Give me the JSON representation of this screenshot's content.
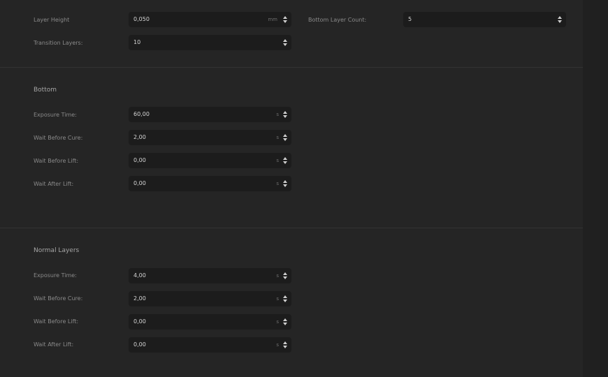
{
  "general": {
    "layer_height": {
      "label": "Layer Height",
      "value": "0,050",
      "unit": "mm"
    },
    "bottom_layer_count": {
      "label": "Bottom Layer Count:",
      "value": "5"
    },
    "transition_layers": {
      "label": "Transition Layers:",
      "value": "10"
    }
  },
  "bottom": {
    "title": "Bottom",
    "exposure_time": {
      "label": "Exposure Time:",
      "value": "60,00",
      "unit": "s"
    },
    "wait_before_cure": {
      "label": "Wait Before Cure:",
      "value": "2,00",
      "unit": "s"
    },
    "wait_before_lift": {
      "label": "Wait Before Lift:",
      "value": "0,00",
      "unit": "s"
    },
    "wait_after_lift": {
      "label": "Wait After Lift:",
      "value": "0,00",
      "unit": "s"
    }
  },
  "normal": {
    "title": "Normal Layers",
    "exposure_time": {
      "label": "Exposure Time:",
      "value": "4,00",
      "unit": "s"
    },
    "wait_before_cure": {
      "label": "Wait Before Cure:",
      "value": "2,00",
      "unit": "s"
    },
    "wait_before_lift": {
      "label": "Wait Before Lift:",
      "value": "0,00",
      "unit": "s"
    },
    "wait_after_lift": {
      "label": "Wait After Lift:",
      "value": "0,00",
      "unit": "s"
    }
  },
  "icons": {
    "spinner": "up-down-arrows-icon"
  }
}
